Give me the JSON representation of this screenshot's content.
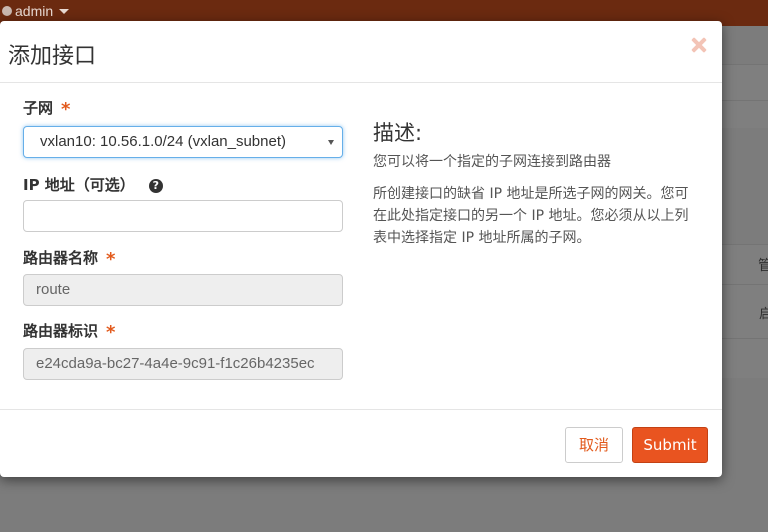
{
  "topbar": {
    "user": "admin"
  },
  "background": {
    "col_header": "管",
    "cell_text": "启"
  },
  "modal": {
    "title": "添加接口",
    "close_symbol": "✕"
  },
  "form": {
    "subnet": {
      "label": "子网",
      "required_mark": "*",
      "value": "vxlan10: 10.56.1.0/24 (vxlan_subnet)"
    },
    "ip_address": {
      "label": "IP 地址（可选）",
      "help_symbol": "?",
      "value": ""
    },
    "router_name": {
      "label": "路由器名称",
      "required_mark": "*",
      "value": "route"
    },
    "router_id": {
      "label": "路由器标识",
      "required_mark": "*",
      "value": "e24cda9a-bc27-4a4e-9c91-f1c26b4235ec"
    }
  },
  "description": {
    "title": "描述:",
    "para1": "您可以将一个指定的子网连接到路由器",
    "para2": "所创建接口的缺省 IP 地址是所选子网的网关。您可在此处指定接口的另一个 IP 地址。您必须从以上列表中选择指定 IP 地址所属的子网。"
  },
  "footer": {
    "cancel_label": "取消",
    "submit_label": "Submit"
  },
  "colors": {
    "accent": "#e95420",
    "required": "#e25a1c",
    "topbar": "#6b2a10",
    "focus_border": "#66afe9"
  }
}
